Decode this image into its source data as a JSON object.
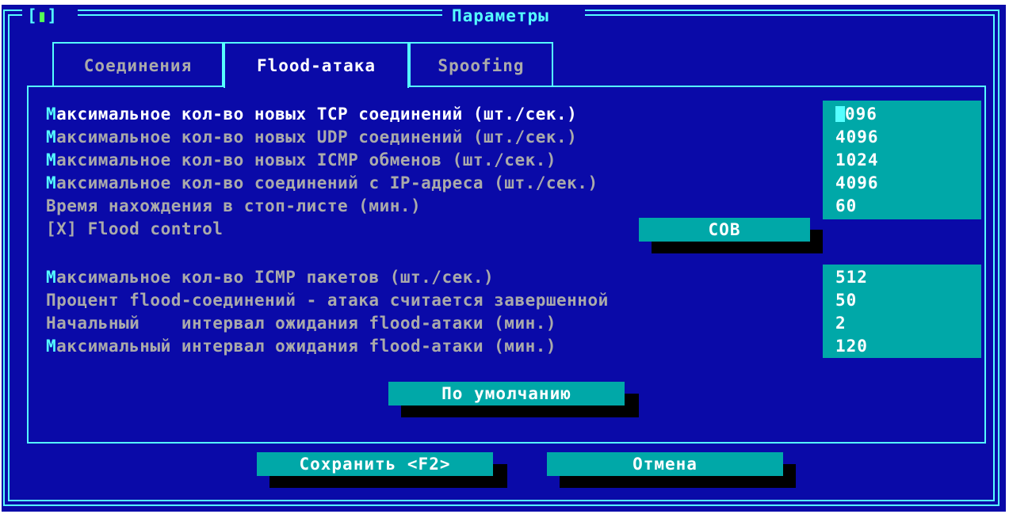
{
  "window": {
    "title": "Параметры",
    "close_left": "[",
    "close_mark": "▮",
    "close_right": "]"
  },
  "tabs": [
    {
      "label": "Соединения",
      "active": false
    },
    {
      "label": "Flood-атака",
      "active": true
    },
    {
      "label": "Spoofing",
      "active": false
    }
  ],
  "group1": {
    "rows": [
      {
        "first": "М",
        "rest": "аксимальное кол-во новых TCP соединений (шт./сек.)",
        "value": "096"
      },
      {
        "first": "М",
        "rest": "аксимальное кол-во новых UDP соединений (шт./сек.)",
        "value": "4096"
      },
      {
        "first": "М",
        "rest": "аксимальное кол-во новых ICMP обменов (шт./сек.)",
        "value": "1024"
      },
      {
        "first": "М",
        "rest": "аксимальное кол-во соединений с IP-адреса (шт./сек.)",
        "value": "4096"
      },
      {
        "first": "",
        "rest": "Время нахождения в стоп-листе (мин.)",
        "value": "60"
      }
    ],
    "checkbox_label": "[X] Flood control",
    "cob_button": "СОВ"
  },
  "group2": {
    "rows": [
      {
        "first": "М",
        "rest": "аксимальное кол-во ICMP пакетов (шт./сек.)",
        "value": "512"
      },
      {
        "first": "",
        "rest": "Процент flood-соединений - атака считается завершенной",
        "value": "50"
      },
      {
        "first": "",
        "rest": "Начальный    интервал ожидания flood-атаки (мин.)",
        "value": "2"
      },
      {
        "first": "М",
        "rest": "аксимальный интервал ожидания flood-атаки (мин.)",
        "value": "120"
      }
    ]
  },
  "buttons": {
    "defaults": "По умолчанию",
    "save": "Сохранить <F2>",
    "cancel": "Отмена"
  },
  "colors": {
    "background": "#0a0aa8",
    "frame": "#55ffff",
    "field": "#00a8a8",
    "text_dim": "#aaaaaa",
    "text_bright": "#ffffff"
  }
}
